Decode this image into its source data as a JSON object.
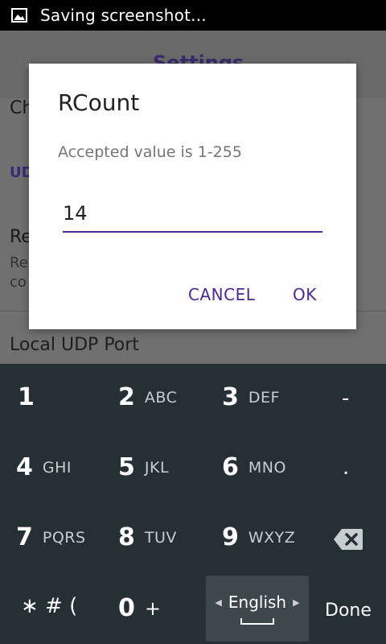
{
  "status_bar": {
    "notification": "Saving screenshot..."
  },
  "background": {
    "title": "Settings",
    "fragments": [
      "Ch",
      "UD",
      "Re",
      "Re",
      "co"
    ],
    "local_udp_port": "Local UDP Port"
  },
  "dialog": {
    "title": "RCount",
    "message": "Accepted value is 1-255",
    "input_value": "14",
    "cancel_label": "CANCEL",
    "ok_label": "OK"
  },
  "keyboard": {
    "keys": [
      {
        "num": "1",
        "letters": ""
      },
      {
        "num": "2",
        "letters": "ABC"
      },
      {
        "num": "3",
        "letters": "DEF"
      },
      {
        "num": "4",
        "letters": "GHI"
      },
      {
        "num": "5",
        "letters": "JKL"
      },
      {
        "num": "6",
        "letters": "MNO"
      },
      {
        "num": "7",
        "letters": "PQRS"
      },
      {
        "num": "8",
        "letters": "TUV"
      },
      {
        "num": "9",
        "letters": "WXYZ"
      },
      {
        "num": "0",
        "letters": "+"
      }
    ],
    "dash": "-",
    "dot": ".",
    "symbols": "∗ # (",
    "language": "English",
    "done": "Done"
  }
}
